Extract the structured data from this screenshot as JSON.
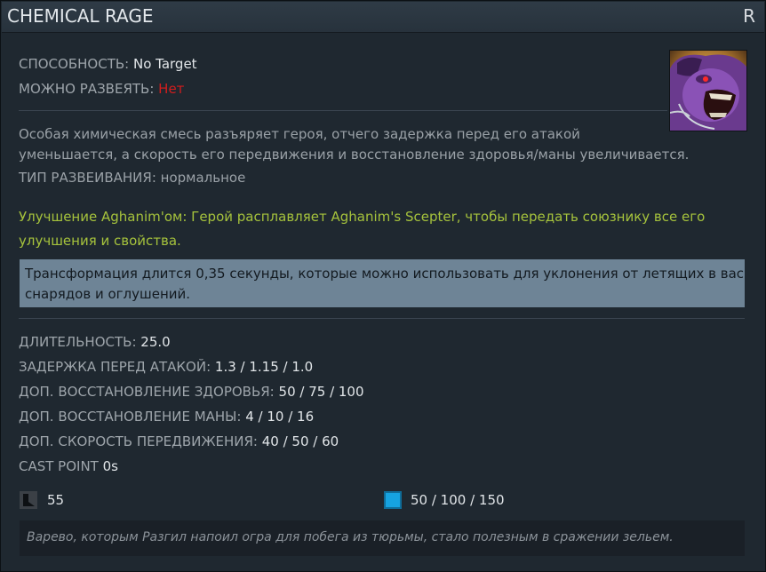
{
  "header": {
    "title": "CHEMICAL RAGE",
    "hotkey": "R"
  },
  "ability": {
    "behavior_label": "СПОСОБНОСТЬ:",
    "behavior_value": "No Target",
    "dispellable_label": "МОЖНО РАЗВЕЯТЬ:",
    "dispellable_value": "Нет"
  },
  "description": {
    "line1": "Особая химическая смесь разъяряет героя, отчего задержка перед его атакой",
    "line2": "уменьшается, а скорость его передвижения и восстановление здоровья/маны увеличивается.",
    "dispel_type_label": "ТИП РАЗВЕИВАНИЯ:",
    "dispel_type_value": "нормальное"
  },
  "aghanim": {
    "line1": "Улучшение Aghanim'ом: Герой расплавляет Aghanim's Scepter, чтобы передать союзнику все его",
    "line2": "улучшения и свойства."
  },
  "note": {
    "line1": "Трансформация длится 0,35 секунды, которые можно использовать для уклонения от летящих в вас",
    "line2": "снарядов и оглушений."
  },
  "stats": [
    {
      "label": "ДЛИТЕЛЬНОСТЬ:",
      "value": "25.0"
    },
    {
      "label": "ЗАДЕРЖКА ПЕРЕД АТАКОЙ:",
      "value": "1.3 / 1.15 / 1.0"
    },
    {
      "label": "ДОП. ВОССТАНОВЛЕНИЕ ЗДОРОВЬЯ:",
      "value": "50 / 75 / 100"
    },
    {
      "label": "ДОП. ВОССТАНОВЛЕНИЕ МАНЫ:",
      "value": "4 / 10 / 16"
    },
    {
      "label": "ДОП. СКОРОСТЬ ПЕРЕДВИЖЕНИЯ:",
      "value": "40 / 50 / 60"
    },
    {
      "label": "CAST POINT",
      "value": "0s"
    }
  ],
  "costs": {
    "cooldown_icon": "cooldown-icon",
    "cooldown": "55",
    "mana_icon": "mana-icon",
    "mana": "50 / 100 / 150"
  },
  "lore": "Варево, которым Разгил напоил огра для побега из тюрьмы, стало полезным в сражении зельем.",
  "colors": {
    "background": "#1f2830",
    "titlebar": "#2f3b46",
    "dispellable_no": "#d11d1d",
    "aghanim_text": "#a5c23c",
    "note_background": "#6e8496",
    "mana": "#16a3e0"
  }
}
